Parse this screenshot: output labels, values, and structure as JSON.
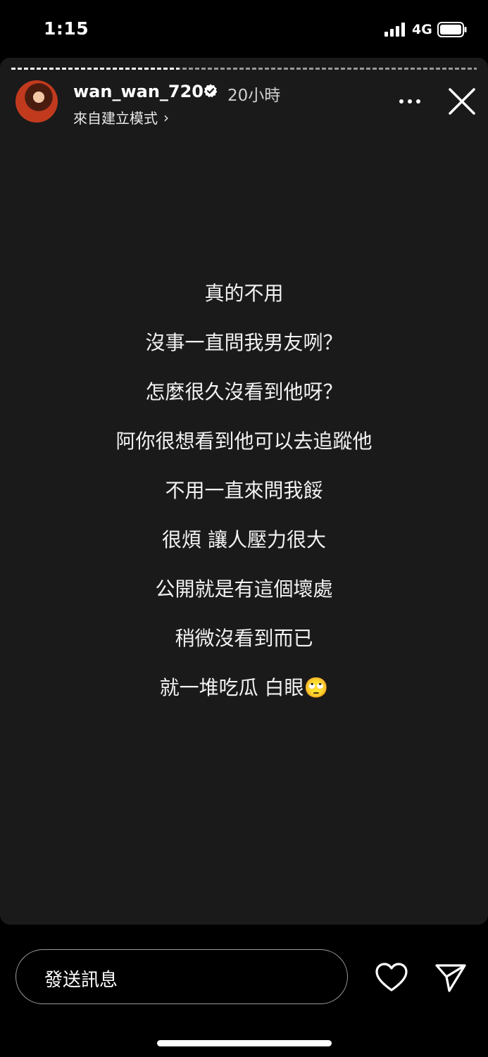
{
  "status_bar": {
    "time": "1:15",
    "network": "4G"
  },
  "story": {
    "username": "wan_wan_720",
    "time_ago": "20小時",
    "source": "來自建立模式",
    "source_chevron": "›",
    "lines": [
      "真的不用",
      "沒事一直問我男友咧？",
      "怎麼很久沒看到他呀？",
      "阿你很想看到他可以去追蹤他",
      "不用一直來問我餒",
      "很煩 讓人壓力很大",
      "公開就是有這個壞處",
      "稍微沒看到而已",
      "就一堆吃瓜 白眼🙄"
    ],
    "progress": 0.36
  },
  "reply": {
    "placeholder": "發送訊息"
  },
  "icons": {
    "signal": "signal-bars-icon",
    "battery": "battery-icon",
    "verified": "verified-badge-icon",
    "more": "more-dots-icon",
    "close": "close-icon",
    "heart": "heart-icon",
    "send": "send-icon"
  },
  "colors": {
    "background": "#000000",
    "story_background": "#1a1a1a",
    "text": "#ffffff"
  }
}
